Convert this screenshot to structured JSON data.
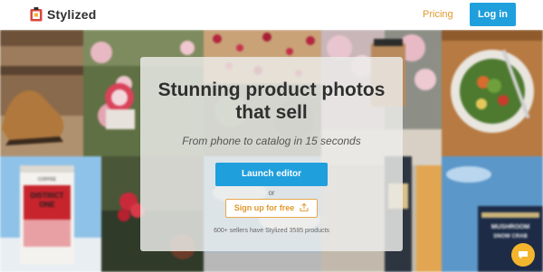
{
  "header": {
    "brand": "Stylized",
    "nav_pricing": "Pricing",
    "login_label": "Log in",
    "logo_icon": "stylized-logo-icon"
  },
  "hero": {
    "headline_line1": "Stunning product photos",
    "headline_line2": "that sell",
    "subheadline": "From phone to catalog in 15 seconds",
    "launch_label": "Launch editor",
    "or_text": "or",
    "signup_label": "Sign up for free",
    "signup_icon": "upload-icon",
    "stats_text": "600+ sellers have Stylized 3585 products"
  },
  "collage": {
    "coffee_bag_top": "COFFEE",
    "coffee_bag_line1": "DISTRICT",
    "coffee_bag_line2": "ONE",
    "mushroom_line1": "MUSHROOM",
    "mushroom_line2": "SNOW CRAB"
  },
  "chat": {
    "icon": "chat-bubble-icon"
  },
  "colors": {
    "accent_blue": "#1f9fdc",
    "accent_orange": "#e0982c",
    "chat_yellow": "#f3b52d"
  }
}
